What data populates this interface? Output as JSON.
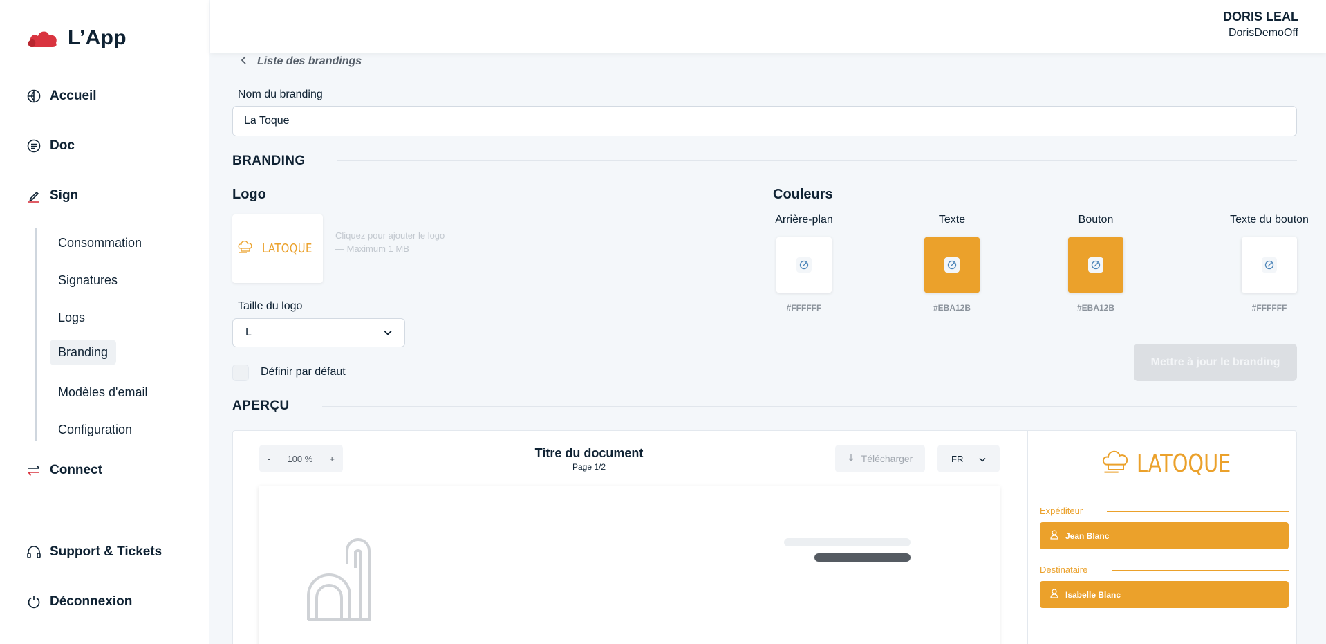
{
  "app": {
    "name": "L’App"
  },
  "user": {
    "name": "DORIS LEAL",
    "org": "DorisDemoOff"
  },
  "nav": {
    "items": [
      {
        "label": "Accueil",
        "icon": "globe-icon"
      },
      {
        "label": "Doc",
        "icon": "doc-icon"
      },
      {
        "label": "Sign",
        "icon": "pen-icon"
      },
      {
        "label": "Connect",
        "icon": "arrows-icon"
      },
      {
        "label": "Support & Tickets",
        "icon": "headset-icon"
      },
      {
        "label": "Déconnexion",
        "icon": "power-icon"
      }
    ],
    "sign_sub": [
      "Consommation",
      "Signatures",
      "Logs",
      "Branding",
      "Modèles d'email",
      "Configuration"
    ]
  },
  "page": {
    "back_label": "Liste des brandings",
    "name_label": "Nom du branding",
    "name_value": "La Toque",
    "branding_title": "BRANDING",
    "logo_title": "Logo",
    "logo_word": "LATOQUE",
    "logo_hint": "Cliquez pour ajouter le logo — Maximum 1 MB",
    "logo_size_label": "Taille du logo",
    "logo_size_value": "L",
    "default_label": "Définir par défaut",
    "colors_title": "Couleurs",
    "colors": [
      {
        "label": "Arrière-plan",
        "hex": "#FFFFFF"
      },
      {
        "label": "Texte",
        "hex": "#EBA12B"
      },
      {
        "label": "Bouton",
        "hex": "#EBA12B"
      },
      {
        "label": "Texte du bouton",
        "hex": "#FFFFFF"
      }
    ],
    "update_button": "Mettre à jour le branding",
    "preview_title": "APERÇU"
  },
  "preview": {
    "zoom_minus": "-",
    "zoom": "100 %",
    "zoom_plus": "+",
    "doc_title": "Titre du document",
    "page_indicator": "Page 1/2",
    "download": "Télécharger",
    "lang": "FR",
    "sender_label": "Expéditeur",
    "sender_name": "Jean Blanc",
    "recipient_label": "Destinataire",
    "recipient_name": "Isabelle Blanc"
  },
  "colors": {
    "accent": "#EBA12B",
    "brand_red": "#d9343f",
    "text_dark": "#0f2233"
  }
}
